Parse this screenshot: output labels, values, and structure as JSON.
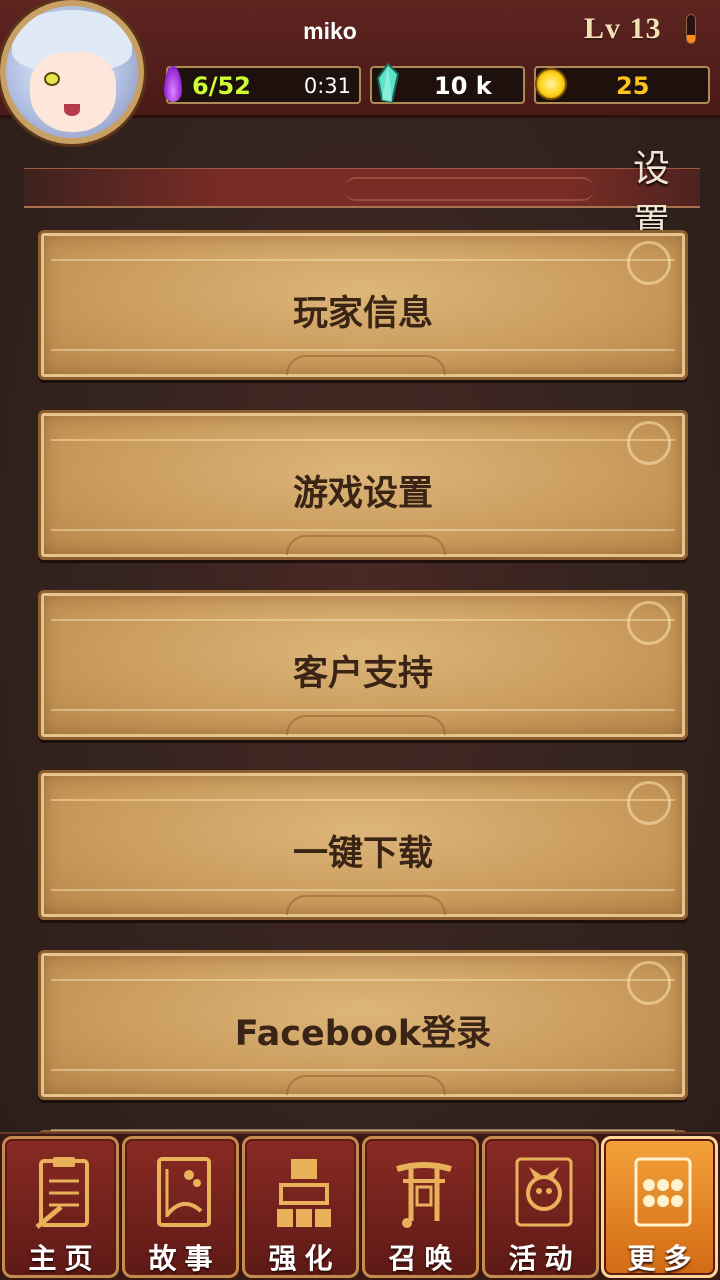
{
  "player": {
    "name": "miko",
    "level_label": "Lv 13",
    "level_progress_fraction": 0.3
  },
  "resources": {
    "energy": "6/52",
    "energy_timer": "0:31",
    "crystals": "10 k",
    "coins": "25"
  },
  "page": {
    "title": "设 置"
  },
  "menu": {
    "items": [
      {
        "label": "玩家信息"
      },
      {
        "label": "游戏设置"
      },
      {
        "label": "客户支持"
      },
      {
        "label": "一键下载"
      },
      {
        "label": "Facebook登录"
      }
    ]
  },
  "nav": {
    "tabs": [
      {
        "label": "主页",
        "icon": "clipboard-icon"
      },
      {
        "label": "故事",
        "icon": "story-book-icon"
      },
      {
        "label": "强化",
        "icon": "blocks-icon"
      },
      {
        "label": "召唤",
        "icon": "torii-gate-icon"
      },
      {
        "label": "活动",
        "icon": "event-creature-icon"
      },
      {
        "label": "更多",
        "icon": "more-grid-icon"
      }
    ],
    "active_index": 5
  },
  "colors": {
    "energy_text": "#ccff33",
    "coin_text": "#ffc21a",
    "active_tab": "#e8892a",
    "button_text": "#3a2415"
  }
}
